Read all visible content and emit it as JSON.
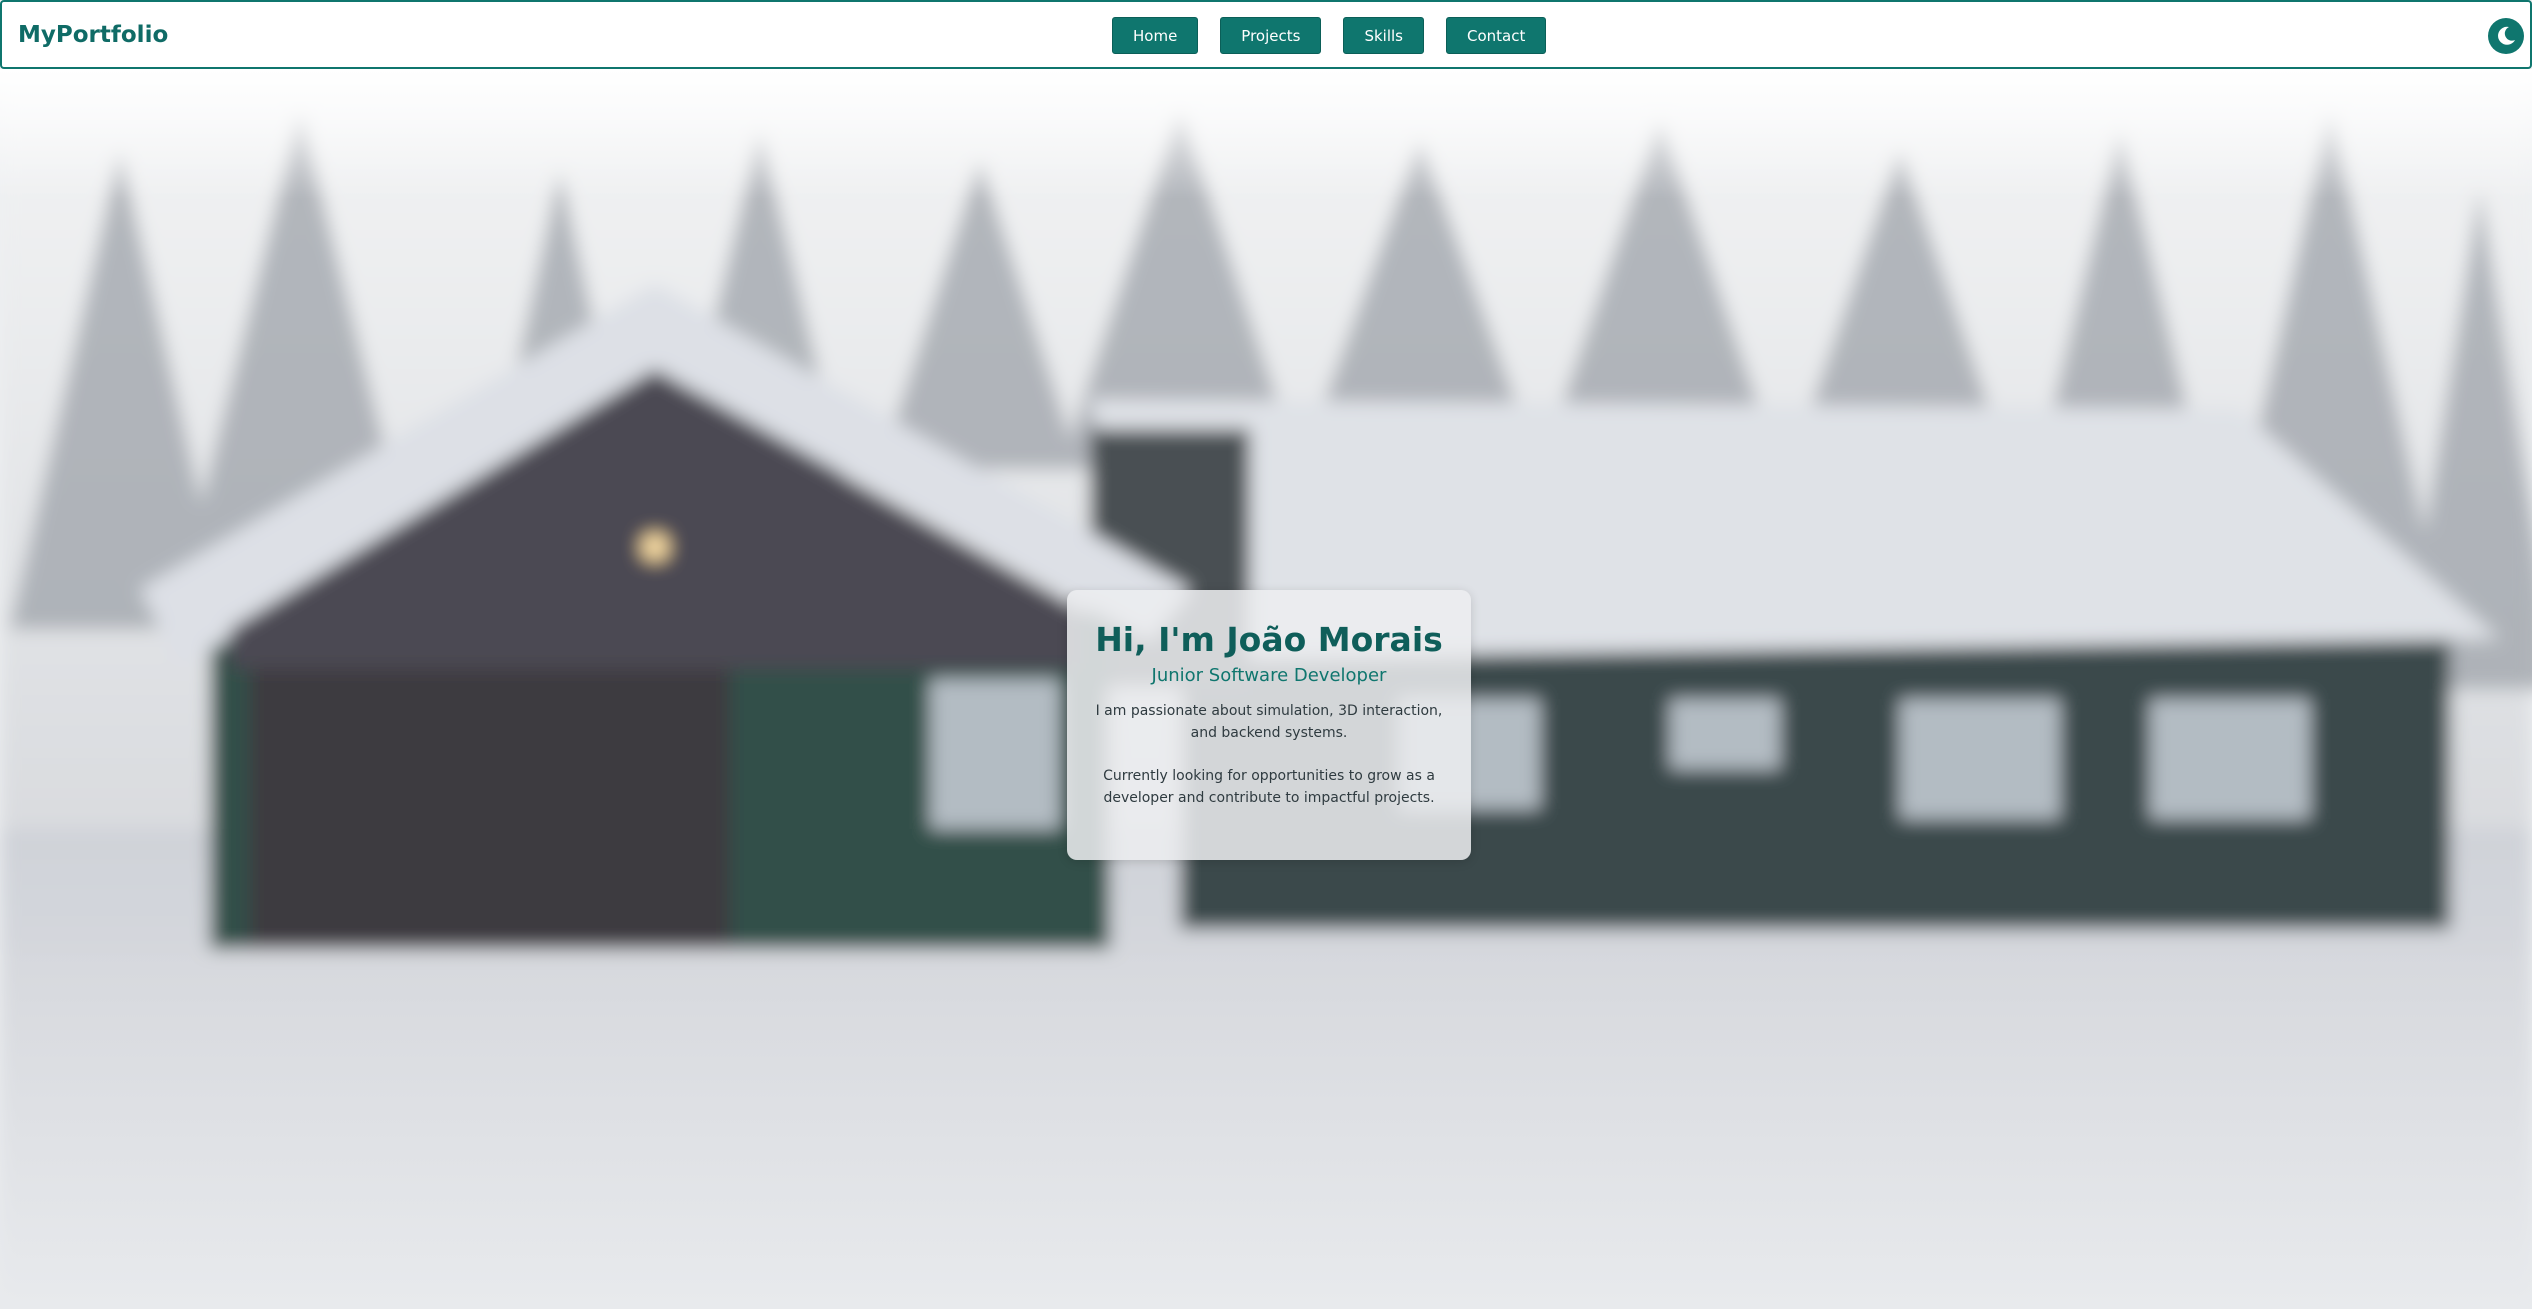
{
  "header": {
    "brand": "MyPortfolio",
    "nav": [
      "Home",
      "Projects",
      "Skills",
      "Contact"
    ],
    "theme_toggle_icon": "moon-icon"
  },
  "hero": {
    "greeting": "Hi, I'm João Morais",
    "role": "Junior Software Developer",
    "intro": "I am passionate about simulation, 3D interaction, and backend systems.",
    "goal": "Currently looking for opportunities to grow as a developer and contribute to impactful projects."
  },
  "colors": {
    "accent": "#0f766e",
    "brand_text": "#0f6b66"
  }
}
